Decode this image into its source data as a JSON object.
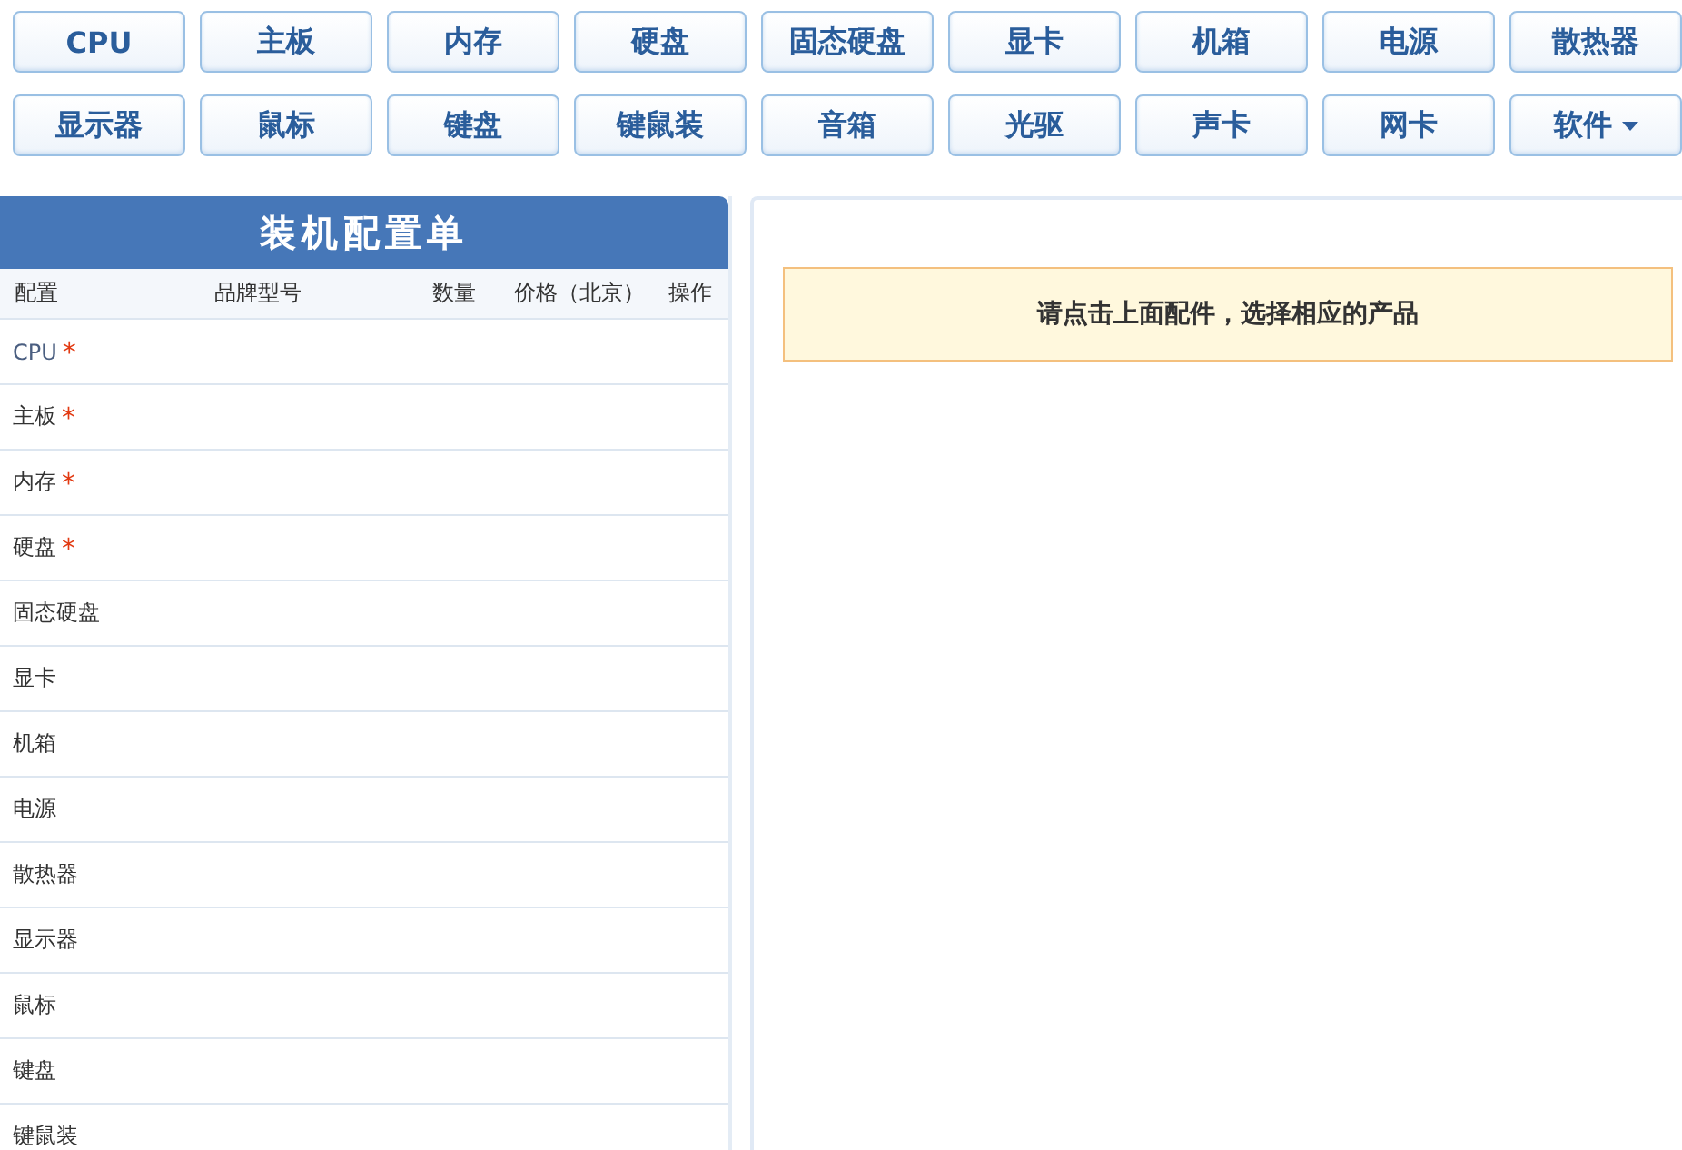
{
  "categories": [
    {
      "label": "CPU",
      "has_menu": false
    },
    {
      "label": "主板",
      "has_menu": false
    },
    {
      "label": "内存",
      "has_menu": false
    },
    {
      "label": "硬盘",
      "has_menu": false
    },
    {
      "label": "固态硬盘",
      "has_menu": false
    },
    {
      "label": "显卡",
      "has_menu": false
    },
    {
      "label": "机箱",
      "has_menu": false
    },
    {
      "label": "电源",
      "has_menu": false
    },
    {
      "label": "散热器",
      "has_menu": false
    },
    {
      "label": "显示器",
      "has_menu": false
    },
    {
      "label": "鼠标",
      "has_menu": false
    },
    {
      "label": "键盘",
      "has_menu": false
    },
    {
      "label": "键鼠装",
      "has_menu": false
    },
    {
      "label": "音箱",
      "has_menu": false
    },
    {
      "label": "光驱",
      "has_menu": false
    },
    {
      "label": "声卡",
      "has_menu": false
    },
    {
      "label": "网卡",
      "has_menu": false
    },
    {
      "label": "软件",
      "has_menu": true
    }
  ],
  "config": {
    "title": "装机配置单",
    "columns": [
      "配置",
      "品牌型号",
      "数量",
      "价格（北京）",
      "操作"
    ],
    "rows": [
      {
        "name": "CPU",
        "required_mark": "*"
      },
      {
        "name": "主板",
        "required_mark": "*"
      },
      {
        "name": "内存",
        "required_mark": "*"
      },
      {
        "name": "硬盘",
        "required_mark": "*"
      },
      {
        "name": "固态硬盘"
      },
      {
        "name": "显卡"
      },
      {
        "name": "机箱"
      },
      {
        "name": "电源"
      },
      {
        "name": "散热器"
      },
      {
        "name": "显示器"
      },
      {
        "name": "鼠标"
      },
      {
        "name": "键盘"
      },
      {
        "name": "键鼠装"
      }
    ]
  },
  "notice": "请点击上面配件，选择相应的产品"
}
